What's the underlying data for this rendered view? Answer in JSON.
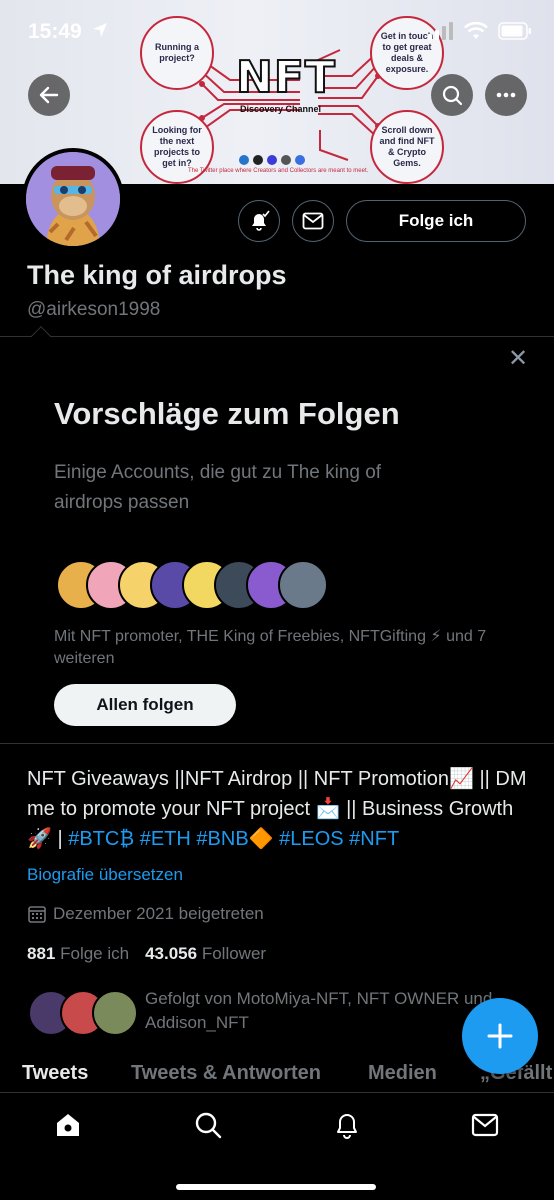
{
  "status_bar": {
    "time": "15:49"
  },
  "banner": {
    "logo_text": "NFT",
    "logo_subtitle": "Discovery Channel",
    "tagline": "The Twitter place where Creators and Collectors are meant to meet.",
    "bubbles": [
      "Running a project?",
      "Get in touch to get great deals & exposure.",
      "Looking for the next projects to get in?",
      "Scroll down and find NFT & Crypto Gems."
    ]
  },
  "profile": {
    "follow_button": "Folge ich",
    "name": "The king of airdrops",
    "handle": "@airkeson1998"
  },
  "suggestions": {
    "close": "✕",
    "title": "Vorschläge zum Folgen",
    "subtitle": "Einige Accounts, die gut zu The king of airdrops passen",
    "names_line": "Mit NFT promoter, THE King of Freebies, NFTGifting ⚡ und 7 weiteren",
    "follow_all_button": "Allen folgen"
  },
  "bio": {
    "text": "NFT Giveaways ||NFT Airdrop || NFT Promotion📈 || DM me to promote your NFT project 📩 || Business Growth 🚀 |",
    "hashtags": [
      "#BTC₿",
      "#ETH",
      "#BNB🔶",
      "#LEOS",
      "#NFT"
    ],
    "translate_link": "Biografie übersetzen",
    "joined": "Dezember 2021 beigetreten",
    "following_count": "881",
    "following_label": "Folge ich",
    "followers_count": "43.056",
    "followers_label": "Follower",
    "followed_by": "Gefolgt von MotoMiya-NFT, NFT OWNER und Addison_NFT"
  },
  "tabs": [
    "Tweets",
    "Tweets & Antworten",
    "Medien",
    "„Gefällt"
  ],
  "colors": {
    "accent": "#1d9bf0",
    "background": "#000000",
    "muted": "#71767b"
  }
}
